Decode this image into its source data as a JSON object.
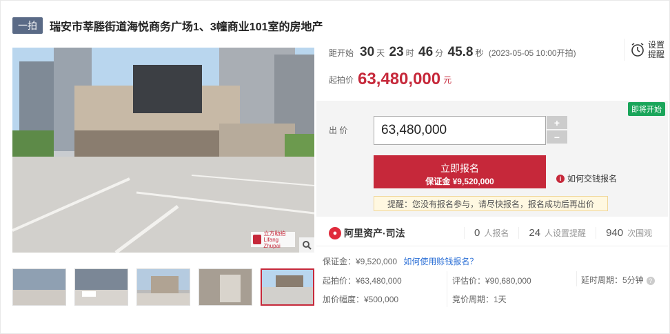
{
  "header": {
    "tag": "一拍",
    "title": "瑞安市莘塍街道海悦商务广场1、3幢商业101室的房地产"
  },
  "gallery": {
    "watermark_line1": "立方助拍",
    "watermark_line2": "Lifang Zhupai",
    "thumb_count": 5,
    "active_thumb": 5
  },
  "countdown": {
    "label": "距开始",
    "days": "30",
    "day_unit": "天",
    "hours": "23",
    "hour_unit": "时",
    "minutes": "46",
    "min_unit": "分",
    "seconds": "45.8",
    "sec_unit": "秒",
    "start_text": "(2023-05-05 10:00开拍)"
  },
  "reminder": {
    "line1": "设置",
    "line2": "提醒"
  },
  "start_price": {
    "label": "起拍价",
    "value": "63,480,000",
    "unit": "元"
  },
  "bid": {
    "badge": "即将开始",
    "label": "出 价",
    "input_value": "63,480,000",
    "plus": "+",
    "minus": "−",
    "button_line1": "立即报名",
    "button_line2": "保证金 ¥9,520,000",
    "howto": "如何交钱报名",
    "tip": "提醒：您没有报名参与，请尽快报名，报名成功后再出价"
  },
  "stats": {
    "brand": "阿里资产·司法",
    "registered_n": "0",
    "registered_s": "人报名",
    "reminders_n": "24",
    "reminders_s": "人设置提醒",
    "views_n": "940",
    "views_s": "次围观"
  },
  "details": {
    "deposit": "保证金：¥9,520,000",
    "deposit_link": "如何使用赊钱报名？",
    "start_price": "起拍价：¥63,480,000",
    "appraisal": "评估价：¥90,680,000",
    "delay": "延时周期：5分钟",
    "increment": "加价幅度：¥500,000",
    "cycle": "竞价周期：1天"
  },
  "colors": {
    "accent": "#c6283a",
    "tag_bg": "#5a6a86",
    "soon_green": "#1aa55a",
    "link_blue": "#2b6fd6"
  }
}
